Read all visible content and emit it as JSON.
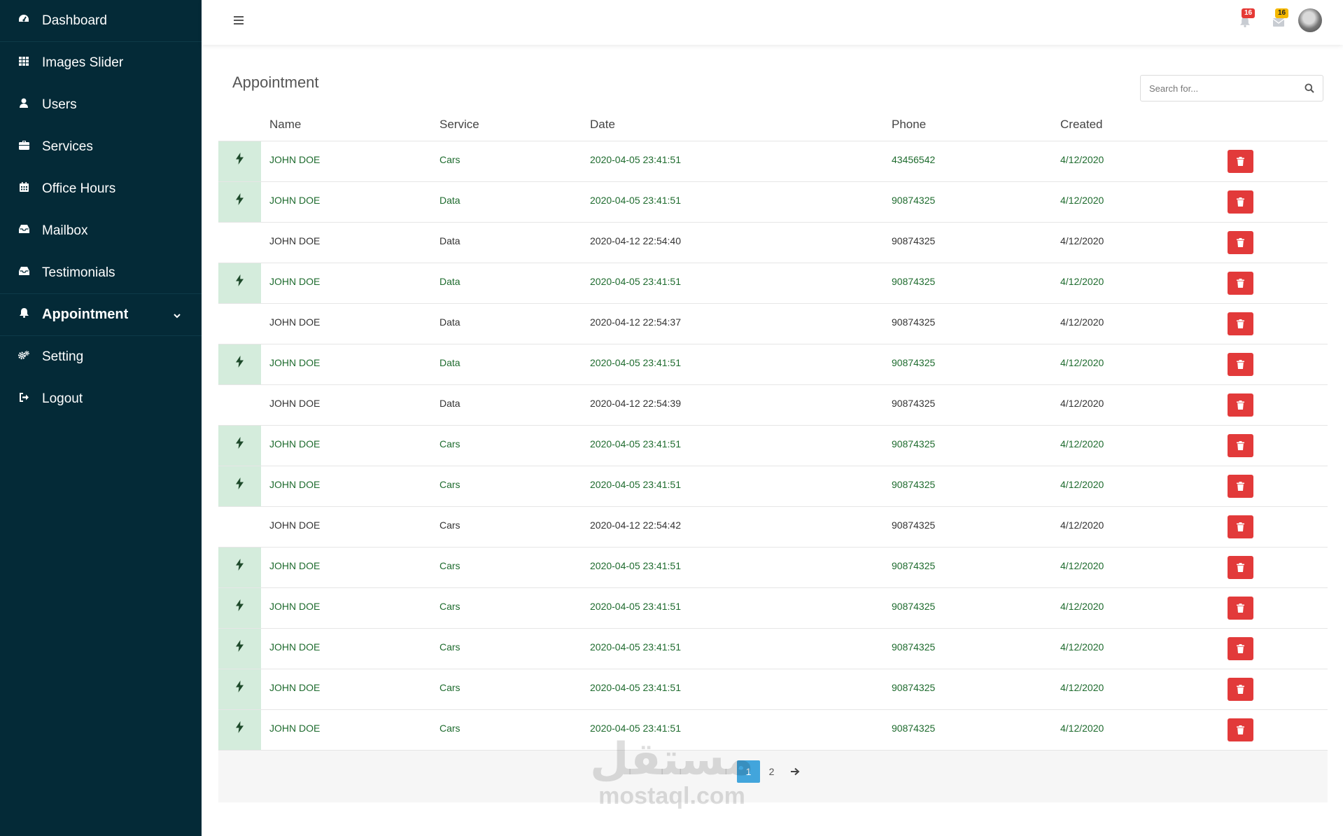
{
  "sidebar": {
    "items": [
      {
        "label": "Dashboard",
        "icon": "dashboard-icon"
      },
      {
        "label": "Images Slider",
        "icon": "grid-icon"
      },
      {
        "label": "Users",
        "icon": "user-icon"
      },
      {
        "label": "Services",
        "icon": "briefcase-icon"
      },
      {
        "label": "Office Hours",
        "icon": "calendar-icon"
      },
      {
        "label": "Mailbox",
        "icon": "inbox-icon"
      },
      {
        "label": "Testimonials",
        "icon": "inbox-icon"
      },
      {
        "label": "Appointment",
        "icon": "bell-icon",
        "active": true
      },
      {
        "label": "Setting",
        "icon": "gears-icon"
      },
      {
        "label": "Logout",
        "icon": "sign-out-icon"
      }
    ]
  },
  "topbar": {
    "notifications_count": "16",
    "messages_count": "16"
  },
  "page": {
    "title": "Appointment",
    "search_placeholder": "Search for..."
  },
  "table": {
    "columns": [
      "Name",
      "Service",
      "Date",
      "Phone",
      "Created"
    ],
    "rows": [
      {
        "highlight": true,
        "name": "JOHN DOE",
        "service": "Cars",
        "date": "2020-04-05 23:41:51",
        "phone": "43456542",
        "created": "4/12/2020"
      },
      {
        "highlight": true,
        "name": "JOHN DOE",
        "service": "Data",
        "date": "2020-04-05 23:41:51",
        "phone": "90874325",
        "created": "4/12/2020"
      },
      {
        "highlight": false,
        "name": "JOHN DOE",
        "service": "Data",
        "date": "2020-04-12 22:54:40",
        "phone": "90874325",
        "created": "4/12/2020"
      },
      {
        "highlight": true,
        "name": "JOHN DOE",
        "service": "Data",
        "date": "2020-04-05 23:41:51",
        "phone": "90874325",
        "created": "4/12/2020"
      },
      {
        "highlight": false,
        "name": "JOHN DOE",
        "service": "Data",
        "date": "2020-04-12 22:54:37",
        "phone": "90874325",
        "created": "4/12/2020"
      },
      {
        "highlight": true,
        "name": "JOHN DOE",
        "service": "Data",
        "date": "2020-04-05 23:41:51",
        "phone": "90874325",
        "created": "4/12/2020"
      },
      {
        "highlight": false,
        "name": "JOHN DOE",
        "service": "Data",
        "date": "2020-04-12 22:54:39",
        "phone": "90874325",
        "created": "4/12/2020"
      },
      {
        "highlight": true,
        "name": "JOHN DOE",
        "service": "Cars",
        "date": "2020-04-05 23:41:51",
        "phone": "90874325",
        "created": "4/12/2020"
      },
      {
        "highlight": true,
        "name": "JOHN DOE",
        "service": "Cars",
        "date": "2020-04-05 23:41:51",
        "phone": "90874325",
        "created": "4/12/2020"
      },
      {
        "highlight": false,
        "name": "JOHN DOE",
        "service": "Cars",
        "date": "2020-04-12 22:54:42",
        "phone": "90874325",
        "created": "4/12/2020"
      },
      {
        "highlight": true,
        "name": "JOHN DOE",
        "service": "Cars",
        "date": "2020-04-05 23:41:51",
        "phone": "90874325",
        "created": "4/12/2020"
      },
      {
        "highlight": true,
        "name": "JOHN DOE",
        "service": "Cars",
        "date": "2020-04-05 23:41:51",
        "phone": "90874325",
        "created": "4/12/2020"
      },
      {
        "highlight": true,
        "name": "JOHN DOE",
        "service": "Cars",
        "date": "2020-04-05 23:41:51",
        "phone": "90874325",
        "created": "4/12/2020"
      },
      {
        "highlight": true,
        "name": "JOHN DOE",
        "service": "Cars",
        "date": "2020-04-05 23:41:51",
        "phone": "90874325",
        "created": "4/12/2020"
      },
      {
        "highlight": true,
        "name": "JOHN DOE",
        "service": "Cars",
        "date": "2020-04-05 23:41:51",
        "phone": "90874325",
        "created": "4/12/2020"
      }
    ]
  },
  "pagination": {
    "pages": [
      "1",
      "2"
    ],
    "current": "1",
    "next_icon": "arrow-right-icon"
  },
  "watermark": {
    "arabic": "مستقل",
    "latin": "mostaql.com"
  },
  "colors": {
    "sidebar_bg": "#042a37",
    "highlight_bg": "#d4ecdc",
    "highlight_text": "#1e6b2e",
    "delete_button": "#e23a3a",
    "pagination_active": "#42a5dc"
  }
}
